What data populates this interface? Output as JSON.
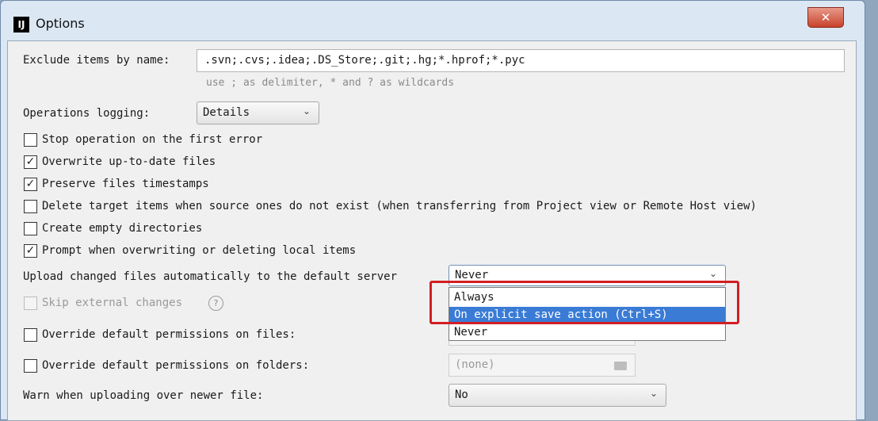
{
  "window": {
    "title": "Options",
    "app_icon_text": "IJ",
    "close_label": "✕"
  },
  "exclude": {
    "label": "Exclude items by name:",
    "value": ".svn;.cvs;.idea;.DS_Store;.git;.hg;*.hprof;*.pyc",
    "hint": "use ; as delimiter, * and ? as wildcards"
  },
  "logging": {
    "label": "Operations logging:",
    "value": "Details"
  },
  "checkboxes": [
    {
      "label": "Stop operation on the first error",
      "checked": false,
      "mark": ""
    },
    {
      "label": "Overwrite up-to-date files",
      "checked": true,
      "mark": "✓"
    },
    {
      "label": "Preserve files timestamps",
      "checked": true,
      "mark": "✓"
    },
    {
      "label": "Delete target items when source ones do not exist (when transferring from Project view or Remote Host view)",
      "checked": false,
      "mark": ""
    },
    {
      "label": "Create empty directories",
      "checked": false,
      "mark": ""
    },
    {
      "label": "Prompt when overwriting or deleting local items",
      "checked": true,
      "mark": "✓"
    }
  ],
  "upload": {
    "label": "Upload changed files automatically to the default server",
    "value": "Never",
    "options": [
      "Always",
      "On explicit save action (Ctrl+S)",
      "Never"
    ],
    "selected_option": "On explicit save action (Ctrl+S)"
  },
  "skip_external": {
    "label": "Skip external changes",
    "help": "?"
  },
  "override_files": {
    "label": "Override default permissions on files:"
  },
  "override_folders": {
    "label": "Override default permissions on folders:",
    "value": "(none)"
  },
  "warn": {
    "label": "Warn when uploading over newer file:",
    "value": "No"
  },
  "colors": {
    "accent": "#3a7bd5",
    "highlight": "#d21e23"
  }
}
